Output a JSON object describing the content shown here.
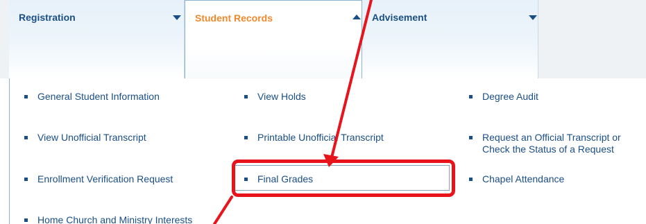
{
  "tabs": [
    {
      "label": "Registration",
      "state": "collapsed",
      "caret": "chevron-down"
    },
    {
      "label": "Student Records",
      "state": "expanded",
      "caret": "chevron-up"
    },
    {
      "label": "Advisement",
      "state": "collapsed",
      "caret": "chevron-down"
    }
  ],
  "menu": {
    "items": [
      {
        "label": "General Student Information"
      },
      {
        "label": "View Holds"
      },
      {
        "label": "Degree Audit"
      },
      {
        "label": "View Unofficial Transcript"
      },
      {
        "label": "Printable Unofficial Transcript"
      },
      {
        "label": "Request an Official Transcript or",
        "line2": "Check the Status of a Request"
      },
      {
        "label": "Enrollment Verification Request"
      },
      {
        "label": "Final Grades"
      },
      {
        "label": "Chapel Attendance"
      },
      {
        "label": "Home Church and Ministry Interests"
      }
    ]
  },
  "colors": {
    "link": "#1a4e86",
    "active_tab": "#f0892c",
    "annotation": "#e8141b",
    "tab_border": "#8ab4d6"
  },
  "annotation": {
    "highlighted_item": "Final Grades",
    "marker": "red-arrow"
  }
}
